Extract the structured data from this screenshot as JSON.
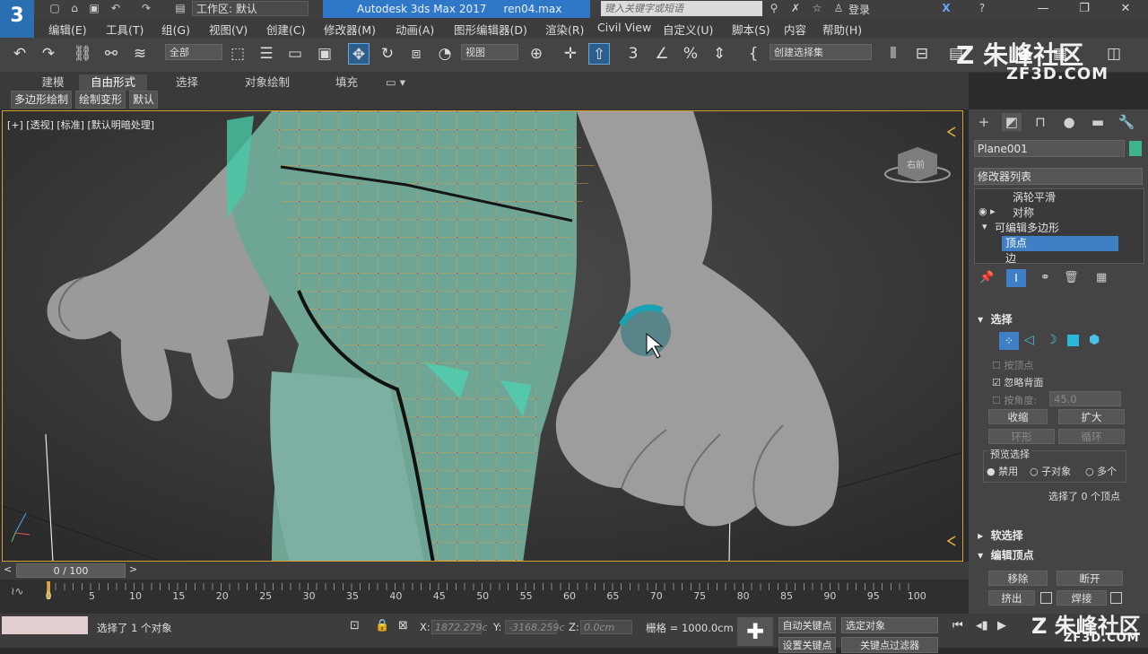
{
  "titlebar": {
    "workspace": "工作区: 默认",
    "app_title": "Autodesk 3ds Max 2017",
    "file_name": "ren04.max",
    "search_placeholder": "键入关键字或短语",
    "login": "登录"
  },
  "menubar": {
    "items": [
      "编辑(E)",
      "工具(T)",
      "组(G)",
      "视图(V)",
      "创建(C)",
      "修改器(M)",
      "动画(A)",
      "图形编辑器(D)",
      "渲染(R)",
      "Civil View",
      "自定义(U)",
      "脚本(S)",
      "内容",
      "帮助(H)"
    ]
  },
  "toolbar": {
    "filter_dropdown": "全部",
    "refcoord_dropdown": "视图",
    "selection_set_dropdown": "创建选择集"
  },
  "ribbon": {
    "tabs": [
      "建模",
      "自由形式",
      "选择",
      "对象绘制",
      "填充"
    ],
    "subtabs": [
      "多边形绘制",
      "绘制变形",
      "默认"
    ]
  },
  "viewport": {
    "label": "[+] [透视] [标准] [默认明暗处理]",
    "viewcube_label": "右前"
  },
  "command_panel": {
    "object_name": "Plane001",
    "object_color": "#3fb38a",
    "modifier_list": "修改器列表",
    "stack": [
      "涡轮平滑",
      "对称",
      "可编辑多边形",
      "顶点",
      "边"
    ],
    "selection_rollout": {
      "title": "选择",
      "by_vertex": "按顶点",
      "ignore_backfacing": "忽略背面",
      "by_angle": "按角度:",
      "angle_value": "45.0",
      "shrink": "收缩",
      "grow": "扩大",
      "ring": "环形",
      "loop": "循环",
      "preview_title": "预览选择",
      "preview_options": [
        "禁用",
        "子对象",
        "多个"
      ],
      "status": "选择了 0 个顶点"
    },
    "soft_selection_title": "软选择",
    "edit_vertices": {
      "title": "编辑顶点",
      "remove": "移除",
      "break": "断开",
      "extrude": "挤出",
      "weld": "焊接"
    }
  },
  "timeline": {
    "frame_display": "0 / 100",
    "ticks": [
      "0",
      "5",
      "10",
      "15",
      "20",
      "25",
      "30",
      "35",
      "40",
      "45",
      "50",
      "55",
      "60",
      "65",
      "70",
      "75",
      "80",
      "85",
      "90",
      "95",
      "100"
    ]
  },
  "statusbar": {
    "message": "选择了 1 个对象",
    "x_value": "1872.279c",
    "y_value": "-3168.259c",
    "z_value": "0.0cm",
    "grid": "栅格 = 1000.0cm",
    "auto_key": "自动关键点",
    "selected_object": "选定对象",
    "set_key": "设置关键点",
    "key_filters": "关键点过滤器"
  },
  "watermark": {
    "text": "朱峰社区",
    "url": "ZF3D.COM"
  }
}
